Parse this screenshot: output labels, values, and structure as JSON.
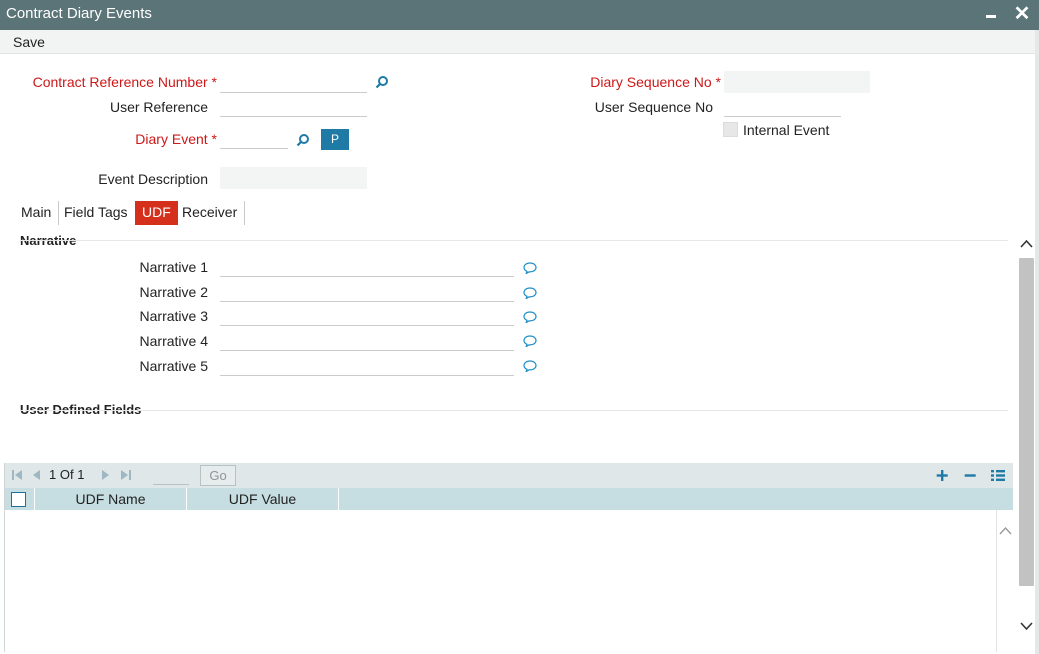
{
  "window": {
    "title": "Contract Diary Events",
    "menu_save": "Save",
    "minimize_icon": "minimize-icon",
    "close_icon": "close-icon",
    "close_glyph": "✕"
  },
  "form": {
    "contract_ref_label": "Contract Reference Number",
    "contract_ref_value": "",
    "user_ref_label": "User Reference",
    "user_ref_value": "",
    "diary_event_label": "Diary Event",
    "diary_event_value": "",
    "p_button_label": "P",
    "event_desc_label": "Event Description",
    "event_desc_value": "",
    "diary_seq_label": "Diary Sequence No",
    "diary_seq_value": "",
    "user_seq_label": "User Sequence No",
    "user_seq_value": "",
    "internal_event_label": "Internal Event",
    "internal_event_checked": false,
    "required_marker": "*"
  },
  "tabs": [
    {
      "label": "Main",
      "active": false
    },
    {
      "label": "Field Tags",
      "active": false
    },
    {
      "label": "UDF",
      "active": true
    },
    {
      "label": "Receiver",
      "active": false
    }
  ],
  "narrative": {
    "section_title": "Narrative",
    "items": [
      {
        "label": "Narrative 1",
        "value": ""
      },
      {
        "label": "Narrative 2",
        "value": ""
      },
      {
        "label": "Narrative 3",
        "value": ""
      },
      {
        "label": "Narrative 4",
        "value": ""
      },
      {
        "label": "Narrative 5",
        "value": ""
      }
    ]
  },
  "udf": {
    "section_title": "User Defined Fields",
    "pager": {
      "current": "1",
      "of_label": "Of",
      "total": "1",
      "go_label": "Go",
      "page_input": ""
    },
    "columns": [
      "UDF Name",
      "UDF Value"
    ],
    "rows": []
  },
  "colors": {
    "titlebar": "#5a7478",
    "required": "#cc1818",
    "active_tab": "#d4301c",
    "accent": "#1f7aa6",
    "grid_header": "#c6dde1"
  }
}
